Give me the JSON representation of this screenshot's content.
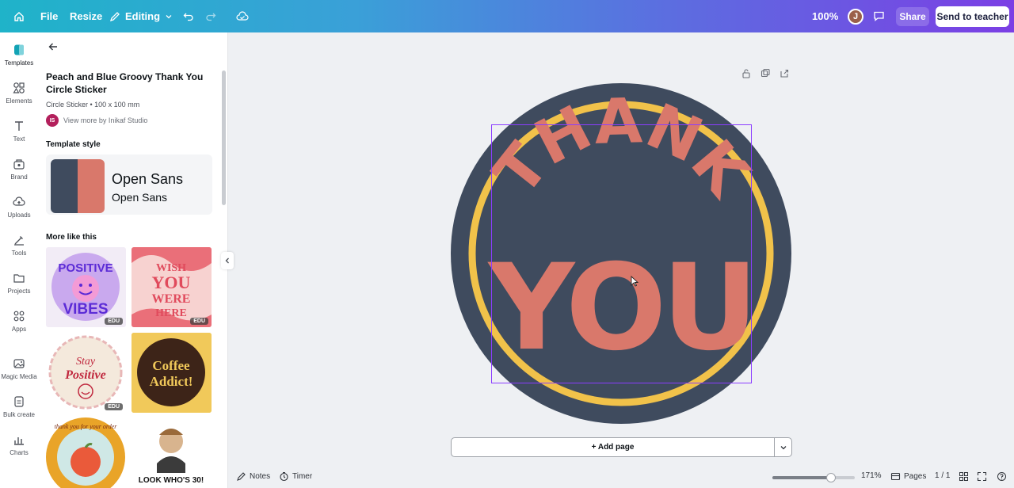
{
  "topbar": {
    "file": "File",
    "resize": "Resize",
    "editing": "Editing",
    "zoom": "100%",
    "avatar_initial": "J",
    "share": "Share",
    "send": "Send to teacher"
  },
  "rail": [
    {
      "label": "Templates",
      "icon": "templates-icon"
    },
    {
      "label": "Elements",
      "icon": "elements-icon"
    },
    {
      "label": "Text",
      "icon": "text-icon"
    },
    {
      "label": "Brand",
      "icon": "brand-icon"
    },
    {
      "label": "Uploads",
      "icon": "uploads-icon"
    },
    {
      "label": "Tools",
      "icon": "tools-icon"
    },
    {
      "label": "Projects",
      "icon": "projects-icon"
    },
    {
      "label": "Apps",
      "icon": "apps-icon"
    },
    {
      "label": "Magic Media",
      "icon": "magic-media-icon"
    },
    {
      "label": "Bulk create",
      "icon": "bulk-create-icon"
    },
    {
      "label": "Charts",
      "icon": "charts-icon"
    }
  ],
  "panel": {
    "title": "Peach and Blue Groovy Thank You Circle Sticker",
    "subtitle": "Circle Sticker • 100 x 100 mm",
    "creator_initials": "IS",
    "creator_link": "View more by Inikaf Studio",
    "template_style": "Template style",
    "font_primary": "Open Sans",
    "font_secondary": "Open Sans",
    "more_like_this": "More like this",
    "edu_badge": "EDU",
    "thumbs": {
      "t1_line1": "POSITIVE",
      "t1_line2": "VIBES",
      "t2_line1": "WISH",
      "t2_line2": "YOU",
      "t2_line3": "WERE",
      "t2_line4": "HERE",
      "t3_line1": "Stay",
      "t3_line2": "Positive",
      "t4_line1": "Coffee",
      "t4_line2": "Addict!",
      "t5_text": "thank you for your order",
      "t6_text": "LOOK WHO'S 30!"
    }
  },
  "canvas": {
    "sticker_line1": "THANK",
    "sticker_line2": "YOU",
    "add_page": "+ Add page"
  },
  "bottombar": {
    "notes": "Notes",
    "timer": "Timer",
    "zoom": "171%",
    "zoom_level": 0.71,
    "pages": "Pages",
    "page_count": "1 / 1"
  },
  "colors": {
    "navy": "#3f4b5e",
    "peach": "#d9786b",
    "yellow": "#f1c24a",
    "cream": "#f6efe4",
    "selection": "#8b3dff"
  }
}
